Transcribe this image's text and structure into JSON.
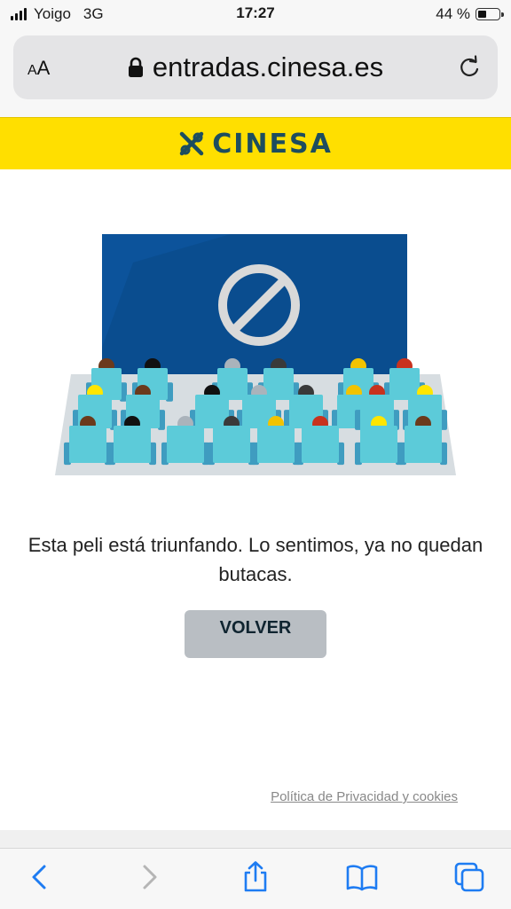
{
  "status_bar": {
    "carrier": "Yoigo",
    "network": "3G",
    "time": "17:27",
    "battery_percent": "44 %",
    "battery_level": 0.44
  },
  "address_bar": {
    "aa_label": "AA",
    "url": "entradas.cinesa.es"
  },
  "brand": {
    "name": "CINESA",
    "bar_color": "#ffdf00",
    "text_color": "#1d4d5f"
  },
  "message": {
    "line1": "Esta peli está triunfando. Lo sentimos, ya no quedan",
    "line2": "butacas."
  },
  "button": {
    "label": "VOLVER"
  },
  "footer": {
    "privacy_link": "Política de Privacidad y cookies"
  },
  "toolbar": {
    "items": [
      "back-icon",
      "forward-icon",
      "share-icon",
      "bookmarks-icon",
      "tabs-icon"
    ]
  },
  "colors": {
    "screen": "#0a4d8f",
    "seat": "#5ccbd9",
    "no_sign": "#d9d9d9"
  }
}
